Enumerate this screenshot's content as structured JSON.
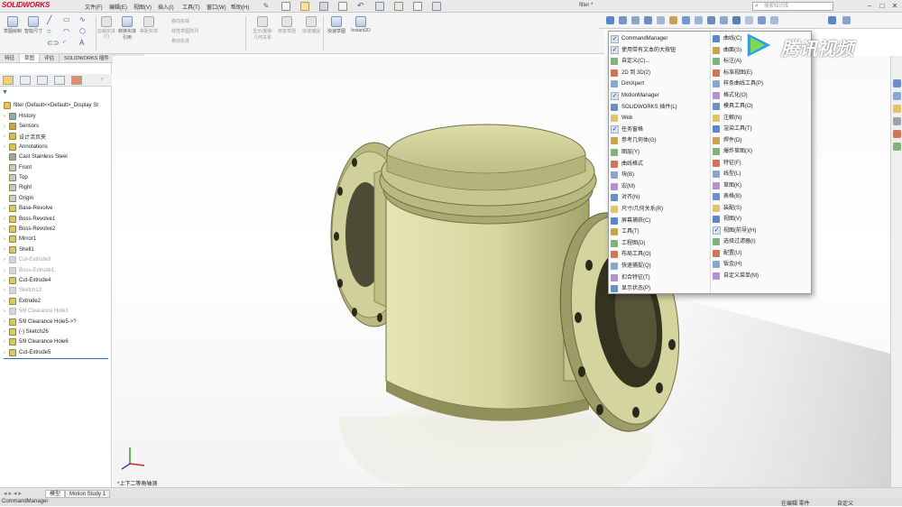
{
  "app": {
    "logo": "SOLIDWORKS",
    "filename": "filter *",
    "search_placeholder": "搜索知识库"
  },
  "menubar": [
    "文件(F)",
    "编辑(E)",
    "视图(V)",
    "插入(I)",
    "工具(T)",
    "窗口(W)",
    "帮助(H)"
  ],
  "ribbon": {
    "buttons": [
      "草图绘制",
      "智能尺寸",
      "剪裁实体(T)",
      "转换实体引用",
      "等距实体",
      "显示/删除几何关系",
      "修复草图",
      "快速捕捉",
      "快速草图",
      "Instant2D"
    ],
    "small_items": [
      "镜向实体",
      "线性草图阵列",
      "移动实体"
    ]
  },
  "command_tabs": [
    "特征",
    "草图",
    "评估",
    "SOLIDWORKS 插件"
  ],
  "feature_tree": {
    "root": "filter  (Default<<Default>_Display St",
    "items": [
      {
        "label": "History",
        "state": "normal"
      },
      {
        "label": "Sensors",
        "state": "normal"
      },
      {
        "label": "设计活页夹",
        "state": "normal"
      },
      {
        "label": "Annotations",
        "state": "normal"
      },
      {
        "label": "Cast Stainless Steel",
        "state": "normal"
      },
      {
        "label": "Front",
        "state": "normal"
      },
      {
        "label": "Top",
        "state": "normal"
      },
      {
        "label": "Right",
        "state": "normal"
      },
      {
        "label": "Origin",
        "state": "normal"
      },
      {
        "label": "Base-Revolve",
        "state": "normal"
      },
      {
        "label": "Boss-Revolve1",
        "state": "normal"
      },
      {
        "label": "Boss-Revolve2",
        "state": "normal"
      },
      {
        "label": "Mirror1",
        "state": "normal"
      },
      {
        "label": "Shell1",
        "state": "normal"
      },
      {
        "label": "Cut-Extrude3",
        "state": "dim"
      },
      {
        "label": "Boss-Extrude1",
        "state": "dim"
      },
      {
        "label": "Cut-Extrude4",
        "state": "normal"
      },
      {
        "label": "Sketch13",
        "state": "dim"
      },
      {
        "label": "Extrude2",
        "state": "normal"
      },
      {
        "label": "5/8 Clearance Hole3",
        "state": "dim"
      },
      {
        "label": "5/8 Clearance Hole5->?",
        "state": "normal"
      },
      {
        "label": "(-) Sketch26",
        "state": "normal"
      },
      {
        "label": "5/8 Clearance Hole6",
        "state": "normal"
      },
      {
        "label": "Cut-Extrude5",
        "state": "normal"
      }
    ]
  },
  "context_menu": {
    "left": [
      {
        "label": "CommandManager",
        "checked": true
      },
      {
        "label": "使用带有文本的大按钮",
        "checked": true
      },
      {
        "label": "自定义(C)...",
        "checked": false
      },
      {
        "label": "2D 到 3D(2)",
        "checked": false
      },
      {
        "label": "DimXpert",
        "checked": false
      },
      {
        "label": "MotionManager",
        "checked": true
      },
      {
        "label": "SOLIDWORKS 插件(L)",
        "checked": false
      },
      {
        "label": "Web",
        "checked": false
      },
      {
        "label": "任务窗格",
        "checked": true
      },
      {
        "label": "参考几何体(G)",
        "checked": false
      },
      {
        "label": "图层(Y)",
        "checked": false
      },
      {
        "label": "曲线格式",
        "checked": false
      },
      {
        "label": "块(B)",
        "checked": false
      },
      {
        "label": "宏(M)",
        "checked": false
      },
      {
        "label": "对齐(N)",
        "checked": false
      },
      {
        "label": "尺寸/几何关系(R)",
        "checked": false
      },
      {
        "label": "屏幕捕获(C)",
        "checked": false
      },
      {
        "label": "工具(T)",
        "checked": false
      },
      {
        "label": "工程图(D)",
        "checked": false
      },
      {
        "label": "布局工具(O)",
        "checked": false
      },
      {
        "label": "快速捕捉(Q)",
        "checked": false
      },
      {
        "label": "扣合特征(T)",
        "checked": false
      },
      {
        "label": "显示状态(P)",
        "checked": false
      }
    ],
    "right": [
      {
        "label": "曲线(C)",
        "checked": false
      },
      {
        "label": "曲面(S)",
        "checked": false
      },
      {
        "label": "标注(A)",
        "checked": false
      },
      {
        "label": "标准视图(E)",
        "checked": false
      },
      {
        "label": "样条曲线工具(P)",
        "checked": false
      },
      {
        "label": "格式化(O)",
        "checked": false
      },
      {
        "label": "模具工具(O)",
        "checked": false
      },
      {
        "label": "注解(N)",
        "checked": false
      },
      {
        "label": "渲染工具(T)",
        "checked": false
      },
      {
        "label": "焊件(D)",
        "checked": false
      },
      {
        "label": "爆炸草图(X)",
        "checked": false
      },
      {
        "label": "特征(F)",
        "checked": false
      },
      {
        "label": "线型(L)",
        "checked": false
      },
      {
        "label": "草图(K)",
        "checked": false
      },
      {
        "label": "表格(B)",
        "checked": false
      },
      {
        "label": "装配(S)",
        "checked": false
      },
      {
        "label": "视图(V)",
        "checked": false
      },
      {
        "label": "视图(前导)(H)",
        "checked": true
      },
      {
        "label": "选择过滤器(I)",
        "checked": false
      },
      {
        "label": "配置(U)",
        "checked": false
      },
      {
        "label": "钣金(H)",
        "checked": false
      },
      {
        "label": "自定义菜单(M)",
        "checked": false
      }
    ]
  },
  "viewport": {
    "view_label": "*上下二等角轴测"
  },
  "bottom_tabs": [
    "模型",
    "Motion Study 1"
  ],
  "status": {
    "left": "CommandManager",
    "mid": "在编辑 零件",
    "right": "自定义"
  },
  "watermark": "腾讯视频",
  "colors": {
    "part": "#d8d9a6",
    "part_shade": "#9fa067",
    "accent": "#1f5fb8",
    "watermark": "#19a9e8"
  }
}
